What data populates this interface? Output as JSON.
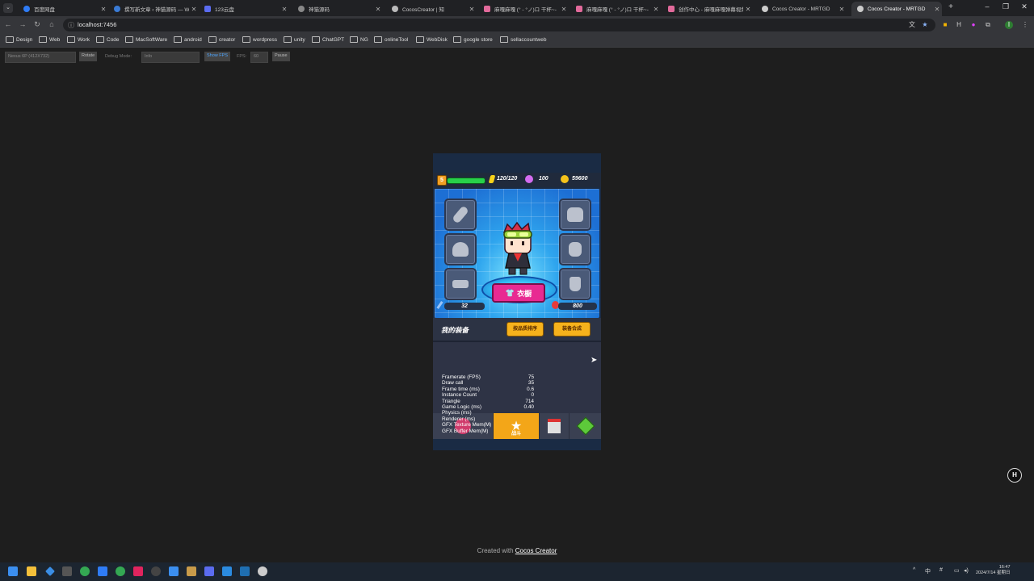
{
  "browser": {
    "tabs": [
      {
        "title": "百度网盘",
        "color": "#2f7cf6"
      },
      {
        "title": "撰写新文章 ‹ 神猫源码 — Wo",
        "color": "#3a7bd5"
      },
      {
        "title": "123云盘",
        "color": "#5b6cf0"
      },
      {
        "title": "神猫源码",
        "color": "#888888"
      },
      {
        "title": "CocosCreator | 知",
        "color": "#bbbbbb"
      },
      {
        "title": "麻嘎麻嘎 (° - °ノ)ロ 干杯~-",
        "color": "#e26a9b"
      },
      {
        "title": "麻嘎麻嘎 (° - °ノ)ロ 干杯~-",
        "color": "#e26a9b"
      },
      {
        "title": "创作中心 - 麻嘎麻嘎弹幕视频",
        "color": "#e26a9b"
      },
      {
        "title": "Cocos Creator - MRTGD",
        "color": "#cccccc"
      },
      {
        "title": "Cocos Creator - MRTGD",
        "color": "#cccccc"
      }
    ],
    "url": "localhost:7456",
    "bookmarks": [
      "Design",
      "Web",
      "Work",
      "Code",
      "MacSoftWare",
      "android",
      "creator",
      "wordpress",
      "unity",
      "ChatGPT",
      "NG",
      "onlineTool",
      "WebDisk",
      "google store",
      "sellaccountweb"
    ]
  },
  "cocos_toolbar": {
    "device": "Nexus 6P (412X732)",
    "rotate": "Rotate",
    "debug_label": "Debug Mode:",
    "debug_value": "Info",
    "show_fps": "Show FPS",
    "fps_label": "FPS:",
    "fps_value": "60",
    "pause": "Pause"
  },
  "game": {
    "level": "5",
    "energy": "120/120",
    "gems": "100",
    "coins": "59600",
    "hp_fraction": 1.0,
    "attack": "32",
    "health": "800",
    "wardrobe": "衣橱",
    "equip_title": "我的装备",
    "btn_sort": "按品质排序",
    "btn_merge": "装备合成",
    "battle_label": "战斗",
    "slots": [
      "weapon",
      "armor",
      "helmet",
      "gloves",
      "belt",
      "boots"
    ]
  },
  "fps_stats": [
    {
      "label": "Framerate (FPS)",
      "value": "75"
    },
    {
      "label": "Draw call",
      "value": "35"
    },
    {
      "label": "Frame time (ms)",
      "value": "0.6"
    },
    {
      "label": "Instance Count",
      "value": "0"
    },
    {
      "label": "Triangle",
      "value": "714"
    },
    {
      "label": "Game Logic (ms)",
      "value": "0.40"
    },
    {
      "label": "Physics (ms)",
      "value": ""
    },
    {
      "label": "Renderer (ms)",
      "value": ""
    },
    {
      "label": "GFX Texture Mem(M)",
      "value": ""
    },
    {
      "label": "GFX Buffer Mem(M)",
      "value": ""
    }
  ],
  "footer": {
    "prefix": "Created with",
    "link": "Cocos Creator"
  },
  "taskbar": {
    "time": "16:47",
    "date": "2024/7/14 星期日",
    "ime": "中"
  }
}
